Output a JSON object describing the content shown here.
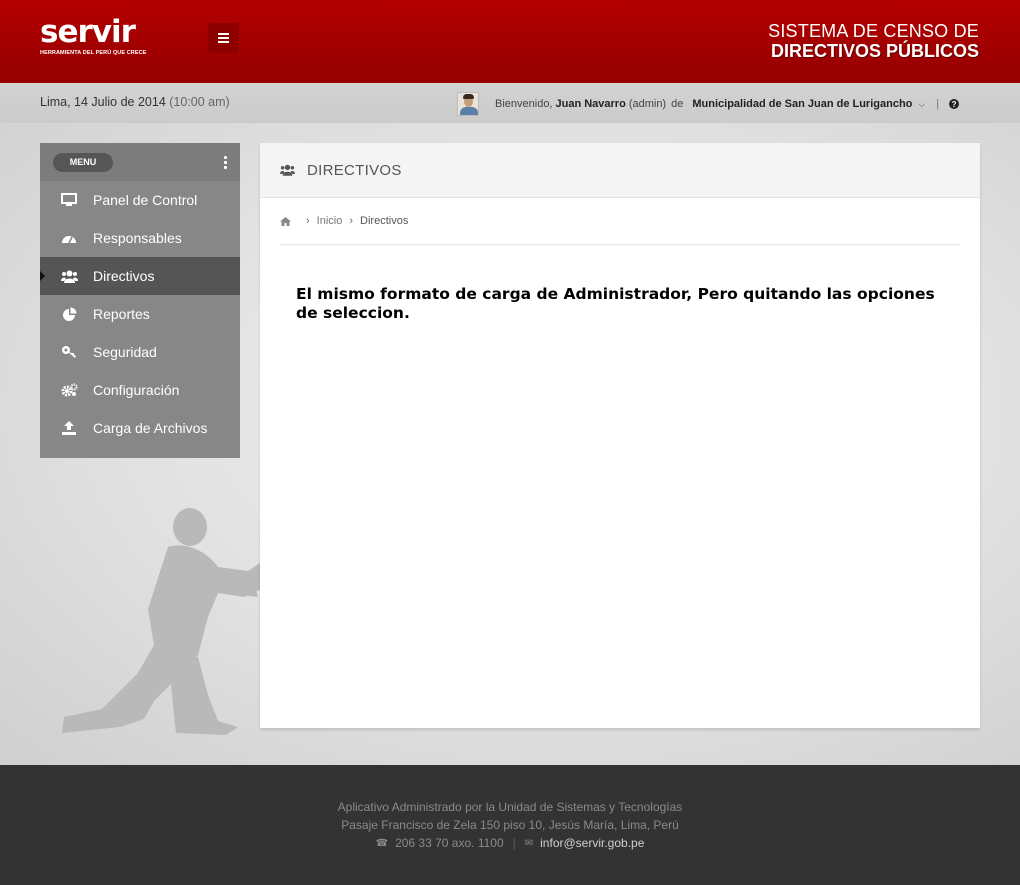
{
  "header": {
    "logo_text": "servir",
    "logo_tagline": "HERRAMIENTA DEL PERÚ QUE CRECE",
    "system_title_line1": "SISTEMA DE CENSO  DE",
    "system_title_line2": "DIRECTIVOS PÚBLICOS",
    "brand_color": "#a80000"
  },
  "subbar": {
    "date": "Lima, 14 Julio de 2014",
    "time": "(10:00 am)",
    "welcome_prefix": "Bienvenido,",
    "user_name": "Juan Navarro",
    "user_role": "(admin)",
    "connector": "de",
    "organization": "Municipalidad de San Juan de Lurigancho",
    "separator": "|",
    "help_symbol": "?"
  },
  "sidebar": {
    "menu_label": "MENU",
    "items": [
      {
        "label": "Panel de Control",
        "icon": "monitor-icon"
      },
      {
        "label": "Responsables",
        "icon": "dashboard-icon"
      },
      {
        "label": "Directivos",
        "icon": "users-icon",
        "active": true
      },
      {
        "label": "Reportes",
        "icon": "pie-chart-icon"
      },
      {
        "label": "Seguridad",
        "icon": "key-icon"
      },
      {
        "label": "Configuración",
        "icon": "gears-icon"
      },
      {
        "label": "Carga de Archivos",
        "icon": "upload-icon"
      }
    ]
  },
  "main": {
    "title": "DIRECTIVOS",
    "breadcrumb": {
      "home_label": "Inicio",
      "current": "Directivos"
    },
    "note": "El mismo formato de carga de Administrador, Pero quitando las opciones de seleccion."
  },
  "footer": {
    "line1": "Aplicativo Administrado por la Unidad de Sistemas y Tecnologías",
    "line2": "Pasaje Francisco de Zela 150 piso 10, Jesús María, Lima, Perú",
    "phone": "206 33 70 axo. 1100",
    "email": "infor@servir.gob.pe"
  }
}
